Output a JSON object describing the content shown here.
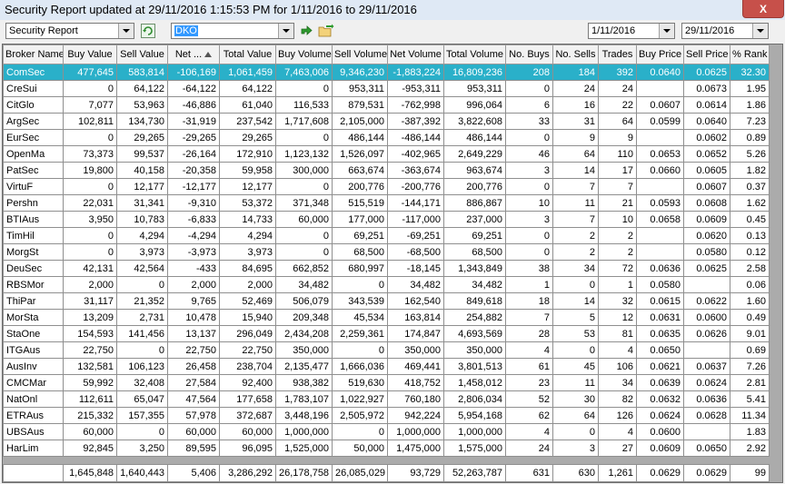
{
  "window": {
    "title": "Security Report updated at 29/11/2016 1:15:53 PM for 1/11/2016 to 29/11/2016",
    "close_label": "X"
  },
  "toolbar": {
    "report_select": "Security Report",
    "code_input": "DKO",
    "date_from": "1/11/2016",
    "date_to": "29/11/2016",
    "icons": [
      "refresh-icon",
      "go-arrow-icon",
      "export-icon"
    ]
  },
  "grid": {
    "columns": [
      "Broker Name",
      "Buy Value",
      "Sell Value",
      "Net ...",
      "Total Value",
      "Buy Volume",
      "Sell Volume",
      "Net Volume",
      "Total Volume",
      "No. Buys",
      "No. Sells",
      "Trades",
      "Buy Price",
      "Sell Price",
      "% Rank"
    ],
    "sorted_column": "Net ...",
    "selected_row": "ComSec",
    "rows": [
      [
        "ComSec",
        "477,645",
        "583,814",
        "-106,169",
        "1,061,459",
        "7,463,006",
        "9,346,230",
        "-1,883,224",
        "16,809,236",
        "208",
        "184",
        "392",
        "0.0640",
        "0.0625",
        "32.30"
      ],
      [
        "CreSui",
        "0",
        "64,122",
        "-64,122",
        "64,122",
        "0",
        "953,311",
        "-953,311",
        "953,311",
        "0",
        "24",
        "24",
        "",
        "0.0673",
        "1.95"
      ],
      [
        "CitGlo",
        "7,077",
        "53,963",
        "-46,886",
        "61,040",
        "116,533",
        "879,531",
        "-762,998",
        "996,064",
        "6",
        "16",
        "22",
        "0.0607",
        "0.0614",
        "1.86"
      ],
      [
        "ArgSec",
        "102,811",
        "134,730",
        "-31,919",
        "237,542",
        "1,717,608",
        "2,105,000",
        "-387,392",
        "3,822,608",
        "33",
        "31",
        "64",
        "0.0599",
        "0.0640",
        "7.23"
      ],
      [
        "EurSec",
        "0",
        "29,265",
        "-29,265",
        "29,265",
        "0",
        "486,144",
        "-486,144",
        "486,144",
        "0",
        "9",
        "9",
        "",
        "0.0602",
        "0.89"
      ],
      [
        "OpenMa",
        "73,373",
        "99,537",
        "-26,164",
        "172,910",
        "1,123,132",
        "1,526,097",
        "-402,965",
        "2,649,229",
        "46",
        "64",
        "110",
        "0.0653",
        "0.0652",
        "5.26"
      ],
      [
        "PatSec",
        "19,800",
        "40,158",
        "-20,358",
        "59,958",
        "300,000",
        "663,674",
        "-363,674",
        "963,674",
        "3",
        "14",
        "17",
        "0.0660",
        "0.0605",
        "1.82"
      ],
      [
        "VirtuF",
        "0",
        "12,177",
        "-12,177",
        "12,177",
        "0",
        "200,776",
        "-200,776",
        "200,776",
        "0",
        "7",
        "7",
        "",
        "0.0607",
        "0.37"
      ],
      [
        "Pershn",
        "22,031",
        "31,341",
        "-9,310",
        "53,372",
        "371,348",
        "515,519",
        "-144,171",
        "886,867",
        "10",
        "11",
        "21",
        "0.0593",
        "0.0608",
        "1.62"
      ],
      [
        "BTIAus",
        "3,950",
        "10,783",
        "-6,833",
        "14,733",
        "60,000",
        "177,000",
        "-117,000",
        "237,000",
        "3",
        "7",
        "10",
        "0.0658",
        "0.0609",
        "0.45"
      ],
      [
        "TimHil",
        "0",
        "4,294",
        "-4,294",
        "4,294",
        "0",
        "69,251",
        "-69,251",
        "69,251",
        "0",
        "2",
        "2",
        "",
        "0.0620",
        "0.13"
      ],
      [
        "MorgSt",
        "0",
        "3,973",
        "-3,973",
        "3,973",
        "0",
        "68,500",
        "-68,500",
        "68,500",
        "0",
        "2",
        "2",
        "",
        "0.0580",
        "0.12"
      ],
      [
        "DeuSec",
        "42,131",
        "42,564",
        "-433",
        "84,695",
        "662,852",
        "680,997",
        "-18,145",
        "1,343,849",
        "38",
        "34",
        "72",
        "0.0636",
        "0.0625",
        "2.58"
      ],
      [
        "RBSMor",
        "2,000",
        "0",
        "2,000",
        "2,000",
        "34,482",
        "0",
        "34,482",
        "34,482",
        "1",
        "0",
        "1",
        "0.0580",
        "",
        "0.06"
      ],
      [
        "ThiPar",
        "31,117",
        "21,352",
        "9,765",
        "52,469",
        "506,079",
        "343,539",
        "162,540",
        "849,618",
        "18",
        "14",
        "32",
        "0.0615",
        "0.0622",
        "1.60"
      ],
      [
        "MorSta",
        "13,209",
        "2,731",
        "10,478",
        "15,940",
        "209,348",
        "45,534",
        "163,814",
        "254,882",
        "7",
        "5",
        "12",
        "0.0631",
        "0.0600",
        "0.49"
      ],
      [
        "StaOne",
        "154,593",
        "141,456",
        "13,137",
        "296,049",
        "2,434,208",
        "2,259,361",
        "174,847",
        "4,693,569",
        "28",
        "53",
        "81",
        "0.0635",
        "0.0626",
        "9.01"
      ],
      [
        "ITGAus",
        "22,750",
        "0",
        "22,750",
        "22,750",
        "350,000",
        "0",
        "350,000",
        "350,000",
        "4",
        "0",
        "4",
        "0.0650",
        "",
        "0.69"
      ],
      [
        "AusInv",
        "132,581",
        "106,123",
        "26,458",
        "238,704",
        "2,135,477",
        "1,666,036",
        "469,441",
        "3,801,513",
        "61",
        "45",
        "106",
        "0.0621",
        "0.0637",
        "7.26"
      ],
      [
        "CMCMar",
        "59,992",
        "32,408",
        "27,584",
        "92,400",
        "938,382",
        "519,630",
        "418,752",
        "1,458,012",
        "23",
        "11",
        "34",
        "0.0639",
        "0.0624",
        "2.81"
      ],
      [
        "NatOnl",
        "112,611",
        "65,047",
        "47,564",
        "177,658",
        "1,783,107",
        "1,022,927",
        "760,180",
        "2,806,034",
        "52",
        "30",
        "82",
        "0.0632",
        "0.0636",
        "5.41"
      ],
      [
        "ETRAus",
        "215,332",
        "157,355",
        "57,978",
        "372,687",
        "3,448,196",
        "2,505,972",
        "942,224",
        "5,954,168",
        "62",
        "64",
        "126",
        "0.0624",
        "0.0628",
        "11.34"
      ],
      [
        "UBSAus",
        "60,000",
        "0",
        "60,000",
        "60,000",
        "1,000,000",
        "0",
        "1,000,000",
        "1,000,000",
        "4",
        "0",
        "4",
        "0.0600",
        "",
        "1.83"
      ],
      [
        "HarLim",
        "92,845",
        "3,250",
        "89,595",
        "96,095",
        "1,525,000",
        "50,000",
        "1,475,000",
        "1,575,000",
        "24",
        "3",
        "27",
        "0.0609",
        "0.0650",
        "2.92"
      ]
    ],
    "totals": [
      "",
      "1,645,848",
      "1,640,443",
      "5,406",
      "3,286,292",
      "26,178,758",
      "26,085,029",
      "93,729",
      "52,263,787",
      "631",
      "630",
      "1,261",
      "0.0629",
      "0.0629",
      "99"
    ]
  },
  "colors": {
    "selected_row": "#2ab0c9",
    "grid_bg": "#ababab",
    "title_bg": "#dfe9f5",
    "close_bg": "#c7504a"
  }
}
